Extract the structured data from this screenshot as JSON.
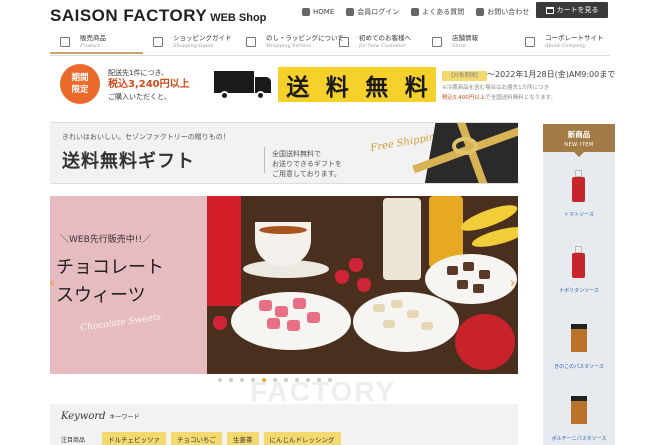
{
  "header": {
    "logo_main": "SAISON FACTORY",
    "logo_sub": "WEB Shop",
    "top_links": [
      {
        "label": "HOME",
        "icon": "home-icon"
      },
      {
        "label": "会員ログイン",
        "icon": "user-icon"
      },
      {
        "label": "よくある質問",
        "icon": "chat-icon"
      },
      {
        "label": "お問い合わせ",
        "icon": "mail-icon"
      }
    ],
    "cart_label": "カートを見る"
  },
  "main_nav": [
    {
      "jp": "販売商品",
      "en": "Product",
      "active": true
    },
    {
      "jp": "ショッピングガイド",
      "en": "Shopping Guide",
      "active": false
    },
    {
      "jp": "のし・ラッピングについて",
      "en": "Wrapping Service",
      "active": false
    },
    {
      "jp": "初めてのお客様へ",
      "en": "for New Customer",
      "active": false
    },
    {
      "jp": "店舗情報",
      "en": "Store",
      "active": false
    },
    {
      "jp": "コーポレートサイト",
      "en": "About Company",
      "active": false
    }
  ],
  "shipping_banner": {
    "badge_line1": "期間",
    "badge_line2": "限定",
    "cond_line1": "配送先1件につき、",
    "cond_price": "税込3,240円以上",
    "cond_line3": "ご購入いただくと、",
    "free_chars": [
      "送",
      "料",
      "無",
      "料"
    ],
    "period_tag": "【対象期間】",
    "period_text": "〜2022年1月28日",
    "period_time": "(金)AM9:00まで",
    "note_line1": "※冷蔵商品を含む場合はお届先1カ所につき",
    "note_line2_red": "税込5,400円以上",
    "note_line2_rest": "で全国送料無料となります。"
  },
  "gift_banner": {
    "line1": "きれいはおいしい。セゾンファクトリーの贈りもの！",
    "title": "送料無料ギフト",
    "desc_line1": "全国送料無料で",
    "desc_line2": "お送りできるギフトを",
    "desc_line3": "ご用意しております。",
    "script": "Free Shipping"
  },
  "hero": {
    "small": "＼WEB先行販売中!!／",
    "big_line1": "チョコレート",
    "big_line2": "スウィーツ",
    "script": "Chocolate Sweets",
    "dots_count": 11,
    "active_dot": 4
  },
  "watermark": "FACTORY",
  "keyword": {
    "title": "Keyword",
    "title_jp": "キーワード",
    "label": "注目商品",
    "tags": [
      "ドルチェビッツァ",
      "チョコいちご",
      "生姜茶",
      "にんじんドレッシング"
    ]
  },
  "sidebar": {
    "title": "新商品",
    "subtitle": "NEW ITEM",
    "products": [
      {
        "name": "トマトソース",
        "kind": "sauce"
      },
      {
        "name": "ナポリタンソース",
        "kind": "sauce"
      },
      {
        "name": "きのこのパスタソース",
        "kind": "jar"
      },
      {
        "name": "ポルチーニパスタソース",
        "kind": "jar"
      }
    ]
  },
  "colors": {
    "accent_gold": "#c9a36a",
    "badge_orange": "#e96a2b",
    "free_yellow": "#f6d12c",
    "hero_pink": "#e6bcc0",
    "sidebar_brown": "#a37b46",
    "tag_yellow": "#f3d96e",
    "cart_dark": "#3a3a3a"
  }
}
